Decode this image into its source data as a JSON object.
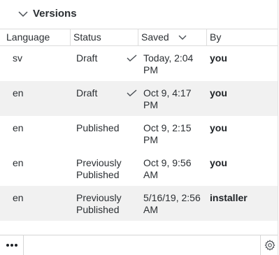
{
  "panel": {
    "title": "Versions"
  },
  "columns": {
    "language": "Language",
    "status": "Status",
    "saved": "Saved",
    "by": "By"
  },
  "rows": [
    {
      "language": "sv",
      "status": "Draft",
      "status_line2": "",
      "saved": "Today, 2:04",
      "saved_line2": "PM",
      "by": "you",
      "checked": true
    },
    {
      "language": "en",
      "status": "Draft",
      "status_line2": "",
      "saved": "Oct 9, 4:17",
      "saved_line2": "PM",
      "by": "you",
      "checked": true
    },
    {
      "language": "en",
      "status": "Published",
      "status_line2": "",
      "saved": "Oct 9, 2:15",
      "saved_line2": "PM",
      "by": "you",
      "checked": false
    },
    {
      "language": "en",
      "status": "Previously",
      "status_line2": "Published",
      "saved": "Oct 9, 9:56",
      "saved_line2": "AM",
      "by": "you",
      "checked": false
    },
    {
      "language": "en",
      "status": "Previously",
      "status_line2": "Published",
      "saved": "5/16/19, 2:56",
      "saved_line2": "AM",
      "by": "installer",
      "checked": false
    }
  ],
  "footer": {
    "more_icon": "ellipsis-icon",
    "settings_icon": "gear-icon"
  },
  "colors": {
    "row_shade": "#f1f1f1",
    "border": "#dcdcdc",
    "text": "#2b2f33"
  }
}
